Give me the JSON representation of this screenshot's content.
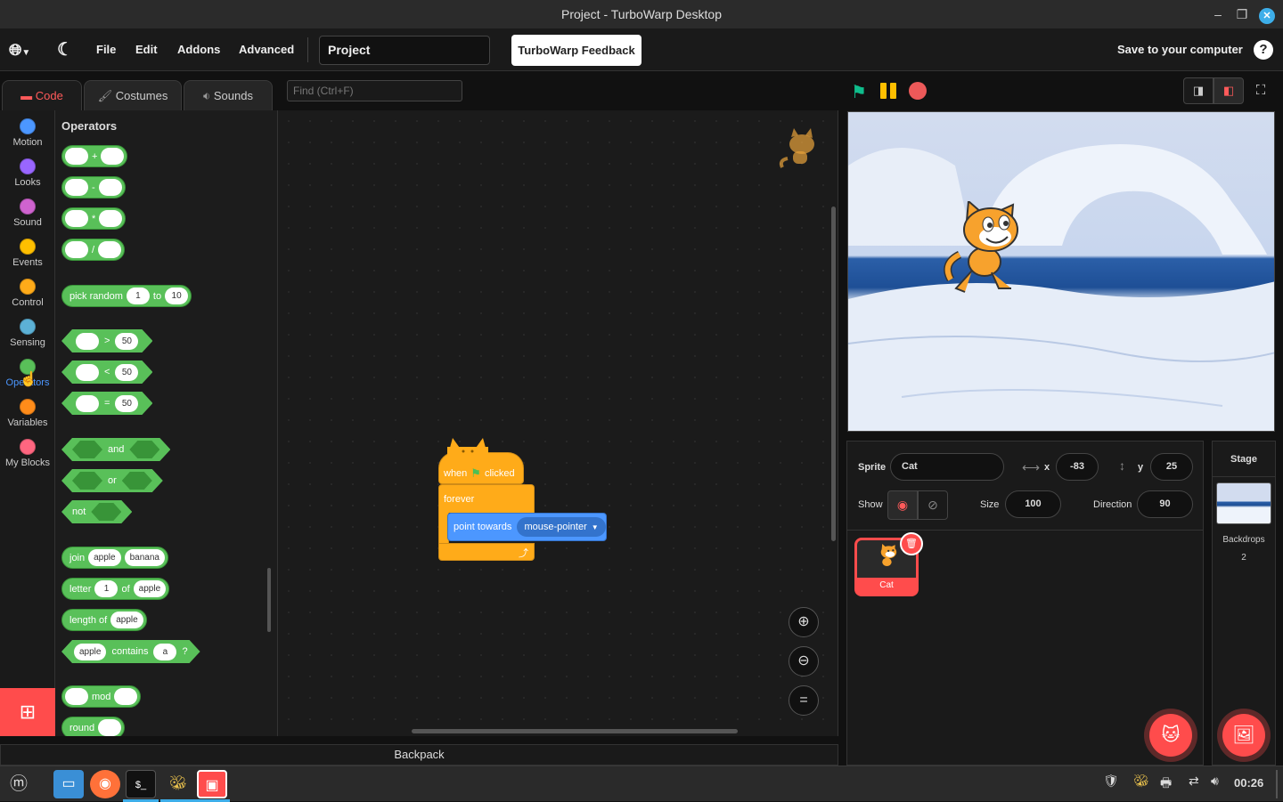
{
  "window": {
    "title": "Project - TurboWarp Desktop"
  },
  "menu": {
    "file": "File",
    "edit": "Edit",
    "addons": "Addons",
    "advanced": "Advanced",
    "project_title": "Project",
    "feedback": "TurboWarp Feedback",
    "save": "Save to your computer",
    "help": "?"
  },
  "tabs": {
    "code": "Code",
    "costumes": "Costumes",
    "sounds": "Sounds"
  },
  "find": {
    "placeholder": "Find (Ctrl+F)"
  },
  "categories": [
    {
      "label": "Motion",
      "color": "#4c97ff"
    },
    {
      "label": "Looks",
      "color": "#9966ff"
    },
    {
      "label": "Sound",
      "color": "#cf63cf"
    },
    {
      "label": "Events",
      "color": "#ffbf00"
    },
    {
      "label": "Control",
      "color": "#ffab19"
    },
    {
      "label": "Sensing",
      "color": "#5cb1d6"
    },
    {
      "label": "Operators",
      "color": "#59c059"
    },
    {
      "label": "Variables",
      "color": "#ff8c1a"
    },
    {
      "label": "My Blocks",
      "color": "#ff6680"
    }
  ],
  "palette": {
    "title": "Operators",
    "add": "+",
    "sub": "-",
    "mul": "*",
    "div": "/",
    "pick_random": "pick random",
    "pick_from": "1",
    "to": "to",
    "pick_to": "10",
    "gt": ">",
    "lt": "<",
    "eq": "=",
    "cmp_value": "50",
    "and": "and",
    "or": "or",
    "not": "not",
    "join": "join",
    "join_a": "apple",
    "join_b": "banana",
    "letter": "letter",
    "letter_n": "1",
    "of": "of",
    "letter_s": "apple",
    "length_of": "length of",
    "length_s": "apple",
    "contains_s": "apple",
    "contains": "contains",
    "contains_c": "a",
    "q": "?",
    "mod": "mod",
    "round": "round"
  },
  "script": {
    "when": "when",
    "clicked": "clicked",
    "forever": "forever",
    "point_towards": "point towards",
    "target": "mouse-pointer"
  },
  "backpack": "Backpack",
  "sprite_info": {
    "sprite_label": "Sprite",
    "sprite_name": "Cat",
    "x_label": "x",
    "x": "-83",
    "y_label": "y",
    "y": "25",
    "show_label": "Show",
    "size_label": "Size",
    "size": "100",
    "direction_label": "Direction",
    "direction": "90"
  },
  "sprites": [
    {
      "name": "Cat"
    }
  ],
  "stage_pane": {
    "title": "Stage",
    "backdrops_label": "Backdrops",
    "backdrops_count": "2"
  },
  "taskbar": {
    "clock": "00:26"
  },
  "colors": {
    "accent": "#ff4c4c",
    "operators": "#59c059",
    "events": "#ffab19",
    "motion": "#4c97ff"
  }
}
